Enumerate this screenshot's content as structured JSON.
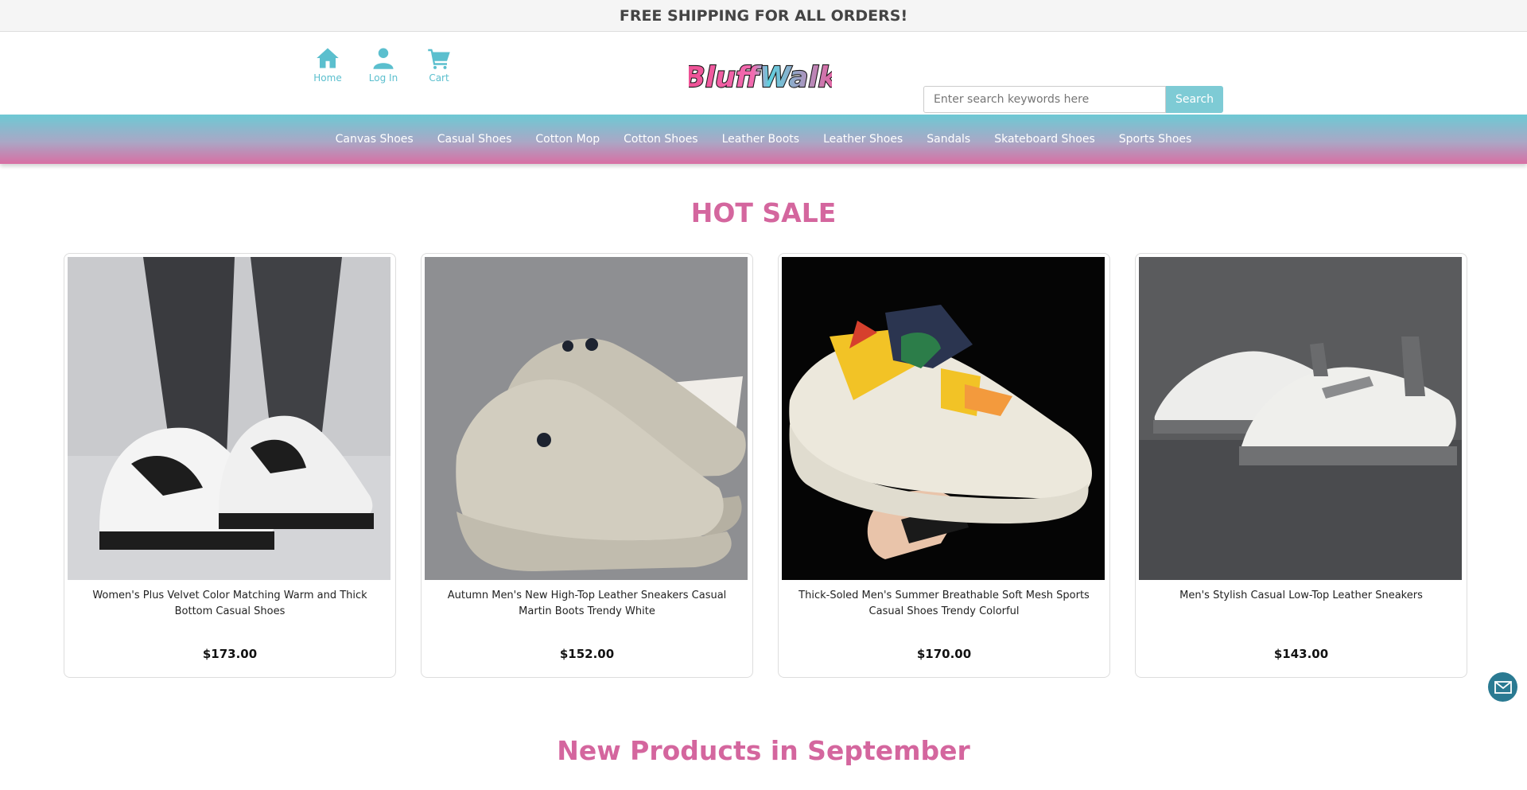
{
  "topbar": {
    "text": "FREE SHIPPING FOR ALL ORDERS!"
  },
  "header": {
    "nav": [
      {
        "label": "Home",
        "icon": "home-icon"
      },
      {
        "label": "Log In",
        "icon": "user-icon"
      },
      {
        "label": "Cart",
        "icon": "cart-icon"
      }
    ],
    "logo": "BluffWalk",
    "search": {
      "placeholder": "Enter search keywords here",
      "button": "Search"
    }
  },
  "menu": [
    "Canvas Shoes",
    "Casual Shoes",
    "Cotton Mop",
    "Cotton Shoes",
    "Leather Boots",
    "Leather Shoes",
    "Sandals",
    "Skateboard Shoes",
    "Sports Shoes"
  ],
  "hot_sale": {
    "title": "HOT SALE",
    "products": [
      {
        "name": "Women's Plus Velvet Color Matching Warm and Thick Bottom Casual Shoes",
        "price": "$173.00"
      },
      {
        "name": "Autumn Men's New High-Top Leather Sneakers Casual Martin Boots Trendy White",
        "price": "$152.00"
      },
      {
        "name": "Thick-Soled Men's Summer Breathable Soft Mesh Sports Casual Shoes Trendy Colorful",
        "price": "$170.00"
      },
      {
        "name": "Men's Stylish Casual Low-Top Leather Sneakers",
        "price": "$143.00"
      }
    ]
  },
  "new_products": {
    "title": "New Products in September"
  },
  "colors": {
    "accent": "#5bbfce",
    "pink": "#d4669e",
    "search_button": "#7ecbd5",
    "mail_button": "#2a7a92"
  },
  "contact": {
    "icon": "mail-icon"
  }
}
